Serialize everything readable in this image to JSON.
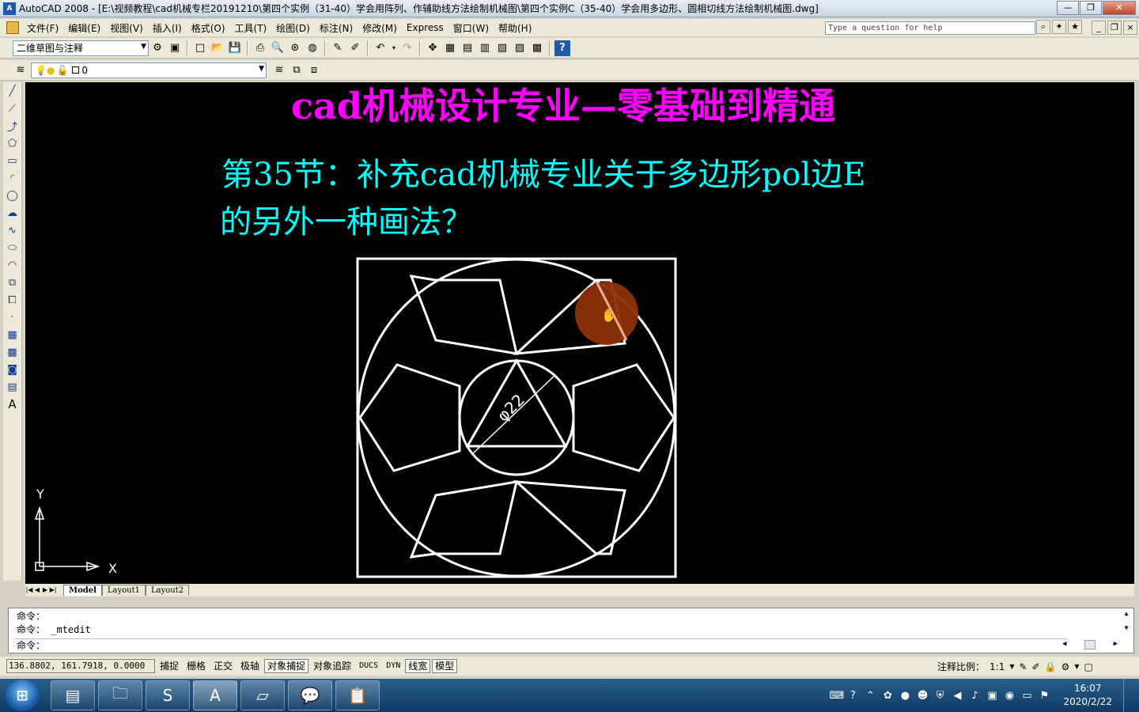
{
  "window": {
    "title": "AutoCAD 2008 - [E:\\视频教程\\cad机械专栏20191210\\第四个实例（31-40）学会用阵列、作辅助线方法绘制机械图\\第四个实例C（35-40）学会用多边形、圆相切线方法绘制机械图.dwg]",
    "app_icon_text": "A"
  },
  "menu": {
    "items": [
      "文件(F)",
      "编辑(E)",
      "视图(V)",
      "插入(I)",
      "格式(O)",
      "工具(T)",
      "绘图(D)",
      "标注(N)",
      "修改(M)",
      "Express",
      "窗口(W)",
      "帮助(H)"
    ],
    "help_placeholder": "Type a question for help"
  },
  "toolbar1": {
    "workspace": "二维草图与注释"
  },
  "toolbar2": {
    "layer": "0"
  },
  "drawing": {
    "heading": "cad机械设计专业—零基础到精通",
    "subtitle_line1": "第35节：补充cad机械专业关于多边形pol边E",
    "subtitle_line2": "的另外一种画法？",
    "dimension": "φ22",
    "ucs_x": "X",
    "ucs_y": "Y",
    "colors": {
      "heading": "#ff00ff",
      "subtitle": "#00ffff",
      "lines": "#ffffff",
      "cursor_highlight": "#8b3208"
    }
  },
  "layout_tabs": [
    "Model",
    "Layout1",
    "Layout2"
  ],
  "command": {
    "history": [
      "命令：",
      "命令：  _mtedit"
    ],
    "prompt": "命令："
  },
  "status": {
    "coords": "136.8802, 161.7918, 0.0000",
    "toggles": [
      "捕捉",
      "栅格",
      "正交",
      "极轴",
      "对象捕捉",
      "对象追踪",
      "DUCS",
      "DYN",
      "线宽",
      "模型"
    ],
    "annotation_scale_label": "注释比例：",
    "annotation_scale_value": "1:1"
  },
  "taskbar": {
    "time": "16:07",
    "date": "2020/2/22"
  }
}
